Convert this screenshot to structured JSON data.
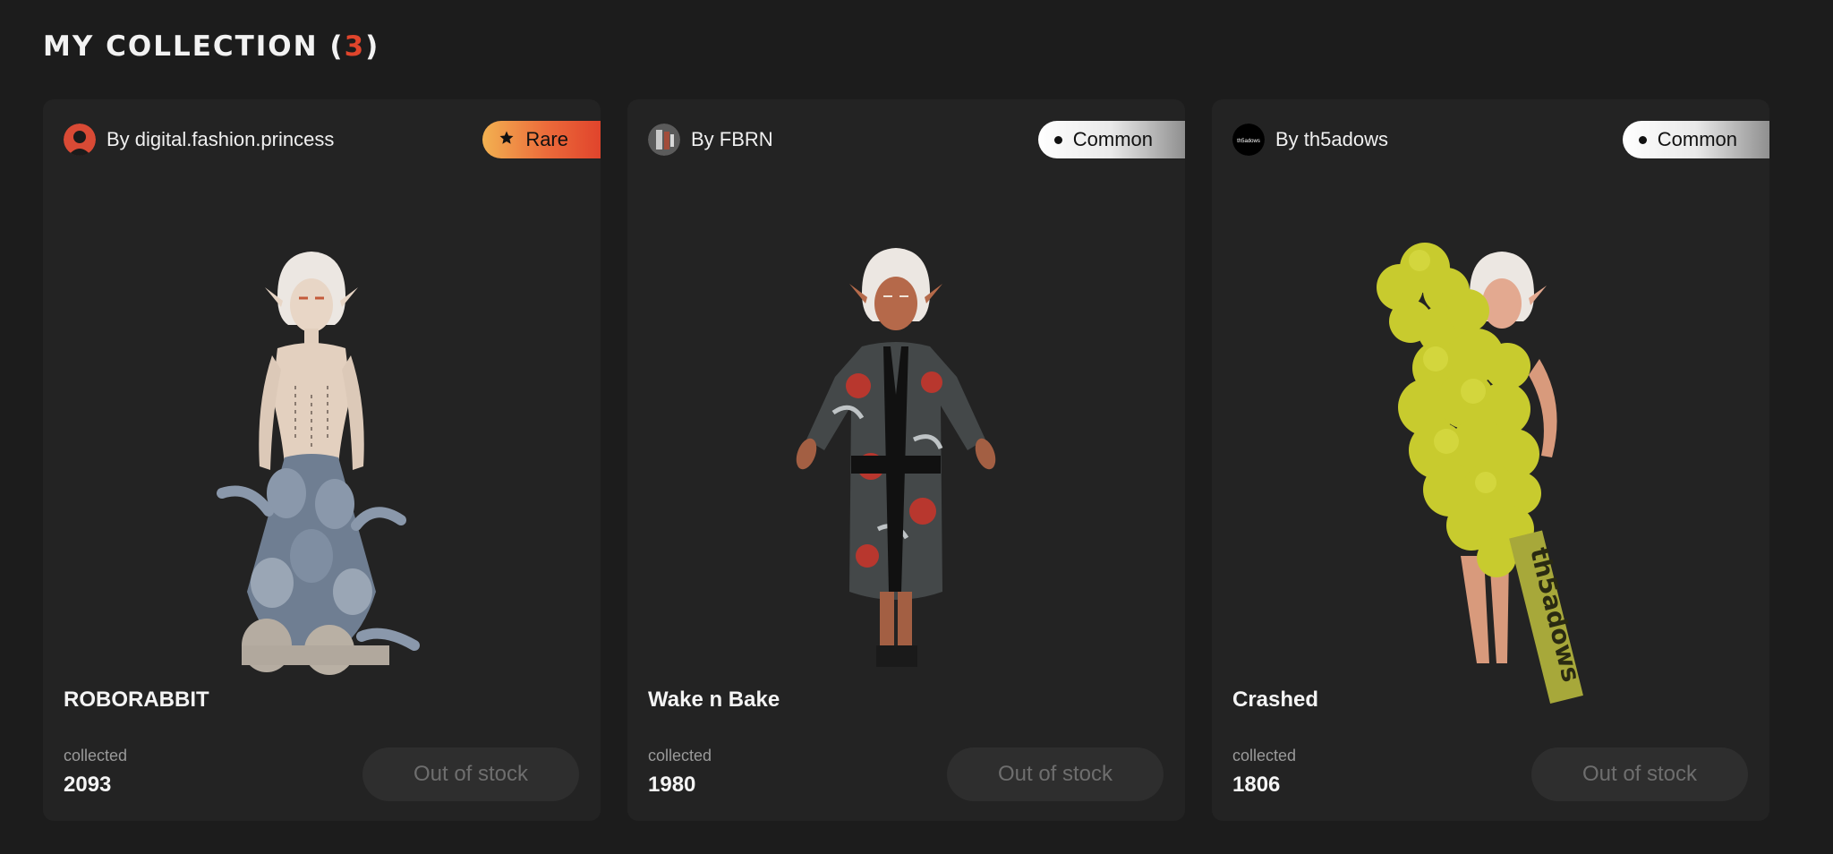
{
  "header": {
    "title": "MY COLLECTION (",
    "count": "3",
    "close": ")"
  },
  "cards": [
    {
      "creator": "By digital.fashion.princess",
      "rarity": "Rare",
      "rarity_icon": "star-icon",
      "name": "ROBORABBIT",
      "collected_label": "collected",
      "collected": "2093",
      "button": "Out of stock"
    },
    {
      "creator": "By FBRN",
      "rarity": "Common",
      "rarity_icon": "dot-icon",
      "name": "Wake n Bake",
      "collected_label": "collected",
      "collected": "1980",
      "button": "Out of stock"
    },
    {
      "creator": "By th5adows",
      "rarity": "Common",
      "rarity_icon": "dot-icon",
      "name": "Crashed",
      "collected_label": "collected",
      "collected": "1806",
      "button": "Out of stock",
      "avatar_text": "th5adows",
      "garment_text": "th5adows"
    }
  ],
  "colors": {
    "background": "#1c1c1c",
    "card": "#232323",
    "accent": "#e0452c",
    "rare_gradient_start": "#f2b151",
    "rare_gradient_end": "#e0442c",
    "button_bg": "#2e2e2e",
    "button_text": "#6e6e6e"
  }
}
